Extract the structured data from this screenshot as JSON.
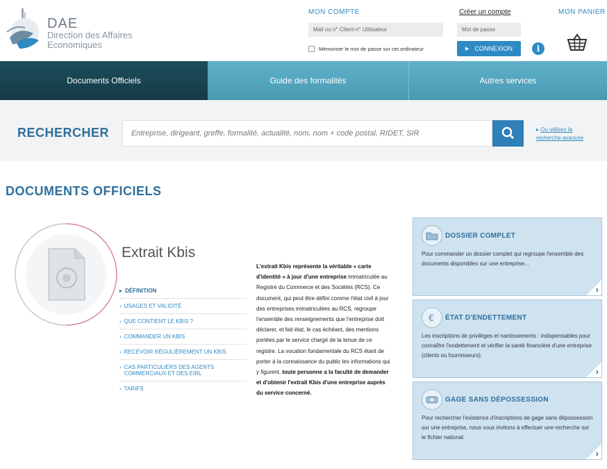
{
  "header": {
    "logo_dae": "DAE",
    "logo_line1": "Direction des Affaires",
    "logo_line2": "Economiques",
    "account_title": "MON COMPTE",
    "account_placeholder": "Mail ou n° Client-n° Utilisateur",
    "create_account": "Créer un compte",
    "password_placeholder": "Mot de passe",
    "remember_label": "Mémoriser le mot de passe sur cet ordinateur",
    "connexion_label": "CONNEXION",
    "info_symbol": "i",
    "cart_title": "MON PANIER"
  },
  "nav": {
    "items": [
      {
        "label": "Documents Officiels",
        "active": true
      },
      {
        "label": "Guide des formalités"
      },
      {
        "label": "Autres services"
      }
    ]
  },
  "search": {
    "label": "RECHERCHER",
    "placeholder": "Entreprise, dirigeant, greffe, formalité, actualité, nom, nom + code postal, RIDET, SIR",
    "adv_line1": "Ou utilisez la",
    "adv_line2": "recherche avancée"
  },
  "page": {
    "title": "DOCUMENTS OFFICIELS",
    "kbis_heading": "Extrait Kbis"
  },
  "menu": {
    "items": [
      {
        "label": "DÉFINITION",
        "active": true
      },
      {
        "label": "USAGES ET VALIDITÉ"
      },
      {
        "label": "QUE CONTIENT LE KBIS ?"
      },
      {
        "label": "COMMANDER UN KBIS"
      },
      {
        "label": "RECEVOIR RÉGULIÈREMENT UN KBIS"
      },
      {
        "label": "CAS PARTICULIERS DES AGENTS COMMERCIAUX ET DES EIRL"
      },
      {
        "label": "TARIFS"
      }
    ]
  },
  "description": {
    "b1": "L'extrait Kbis représente la véritable « carte d'identité » à jour d'une entreprise",
    "t1": " immatriculée au Registre du Commerce et des Sociétés (RCS). Ce document, qui peut être défini comme l'état civil à jour des entreprises immatriculées au RCS, regroupe l'ensemble des renseignements que l'entreprise doit déclarer, et fait état, le cas échéant, des mentions portées par le service chargé de la tenue de ce registre. La vocation fondamentale du RCS étant de porter à la connaissance du public les informations qui y figurent, ",
    "b2": "toute personne a la faculté de demander et d'obtenir l'extrait Kbis d'une entreprise auprès du service concerné."
  },
  "boxes": [
    {
      "title": "DOSSIER COMPLET",
      "text": "Pour commander un dossier complet qui regroupe l'ensemble des documents disponibles sur une entreprise..."
    },
    {
      "title": "ÉTAT D'ENDETTEMENT",
      "text": "Les inscriptions de privilèges et nantissements : indispensables pour connaître l'endettement et vérifier la santé financière d'une entreprise (clients ou fournisseurs)."
    },
    {
      "title": "GAGE SANS DÉPOSSESSION",
      "text": "Pour rechercher l'existence d'inscriptions de gage sans dépossession sur une entreprise, nous vous invitons à effectuer une recherche sur le fichier national."
    }
  ],
  "colors": {
    "accent": "#2f8ac4",
    "nav_dark": "#1d4d5c",
    "nav_light": "#5fb0c9",
    "box_bg": "#cfe2ef",
    "title_blue": "#2f6f9c"
  },
  "icons": [
    "logo-mark-icon",
    "info-icon",
    "basket-icon",
    "search-icon",
    "document-icon",
    "folder-icon",
    "euro-icon",
    "gage-icon",
    "chevron-right-icon"
  ]
}
